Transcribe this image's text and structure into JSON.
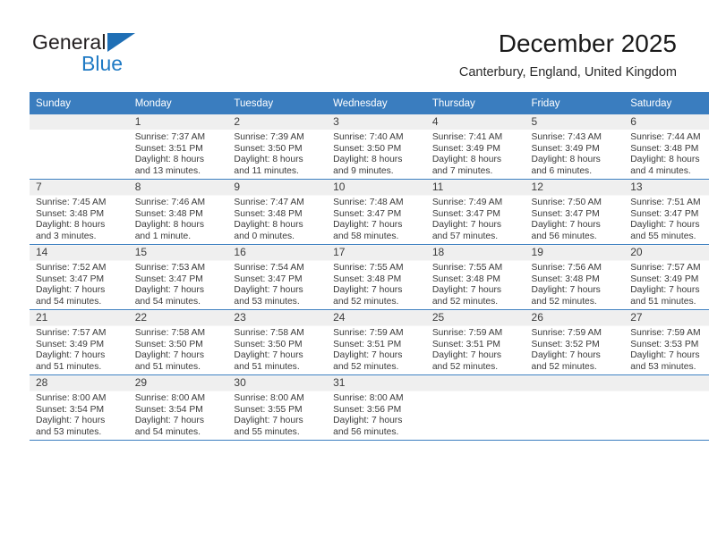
{
  "brand": {
    "name_part1": "General",
    "name_part2": "Blue",
    "triangle_icon": "blue-triangle-icon",
    "colors": {
      "triangle": "#1f6fb5",
      "blue_text": "#1f7ac4",
      "dark_text": "#231f20"
    }
  },
  "header": {
    "title": "December 2025",
    "subtitle": "Canterbury, England, United Kingdom"
  },
  "theme": {
    "header_row_bg": "#3a7dbf",
    "header_row_text": "#ffffff",
    "daynum_band_bg": "#efefef",
    "cell_bg": "#ffffff",
    "row_border": "#3a7dbf"
  },
  "weekday_headers": [
    "Sunday",
    "Monday",
    "Tuesday",
    "Wednesday",
    "Thursday",
    "Friday",
    "Saturday"
  ],
  "weeks": [
    [
      {
        "day": "",
        "lines": []
      },
      {
        "day": "1",
        "lines": [
          "Sunrise: 7:37 AM",
          "Sunset: 3:51 PM",
          "Daylight: 8 hours",
          "and 13 minutes."
        ]
      },
      {
        "day": "2",
        "lines": [
          "Sunrise: 7:39 AM",
          "Sunset: 3:50 PM",
          "Daylight: 8 hours",
          "and 11 minutes."
        ]
      },
      {
        "day": "3",
        "lines": [
          "Sunrise: 7:40 AM",
          "Sunset: 3:50 PM",
          "Daylight: 8 hours",
          "and 9 minutes."
        ]
      },
      {
        "day": "4",
        "lines": [
          "Sunrise: 7:41 AM",
          "Sunset: 3:49 PM",
          "Daylight: 8 hours",
          "and 7 minutes."
        ]
      },
      {
        "day": "5",
        "lines": [
          "Sunrise: 7:43 AM",
          "Sunset: 3:49 PM",
          "Daylight: 8 hours",
          "and 6 minutes."
        ]
      },
      {
        "day": "6",
        "lines": [
          "Sunrise: 7:44 AM",
          "Sunset: 3:48 PM",
          "Daylight: 8 hours",
          "and 4 minutes."
        ]
      }
    ],
    [
      {
        "day": "7",
        "lines": [
          "Sunrise: 7:45 AM",
          "Sunset: 3:48 PM",
          "Daylight: 8 hours",
          "and 3 minutes."
        ]
      },
      {
        "day": "8",
        "lines": [
          "Sunrise: 7:46 AM",
          "Sunset: 3:48 PM",
          "Daylight: 8 hours",
          "and 1 minute."
        ]
      },
      {
        "day": "9",
        "lines": [
          "Sunrise: 7:47 AM",
          "Sunset: 3:48 PM",
          "Daylight: 8 hours",
          "and 0 minutes."
        ]
      },
      {
        "day": "10",
        "lines": [
          "Sunrise: 7:48 AM",
          "Sunset: 3:47 PM",
          "Daylight: 7 hours",
          "and 58 minutes."
        ]
      },
      {
        "day": "11",
        "lines": [
          "Sunrise: 7:49 AM",
          "Sunset: 3:47 PM",
          "Daylight: 7 hours",
          "and 57 minutes."
        ]
      },
      {
        "day": "12",
        "lines": [
          "Sunrise: 7:50 AM",
          "Sunset: 3:47 PM",
          "Daylight: 7 hours",
          "and 56 minutes."
        ]
      },
      {
        "day": "13",
        "lines": [
          "Sunrise: 7:51 AM",
          "Sunset: 3:47 PM",
          "Daylight: 7 hours",
          "and 55 minutes."
        ]
      }
    ],
    [
      {
        "day": "14",
        "lines": [
          "Sunrise: 7:52 AM",
          "Sunset: 3:47 PM",
          "Daylight: 7 hours",
          "and 54 minutes."
        ]
      },
      {
        "day": "15",
        "lines": [
          "Sunrise: 7:53 AM",
          "Sunset: 3:47 PM",
          "Daylight: 7 hours",
          "and 54 minutes."
        ]
      },
      {
        "day": "16",
        "lines": [
          "Sunrise: 7:54 AM",
          "Sunset: 3:47 PM",
          "Daylight: 7 hours",
          "and 53 minutes."
        ]
      },
      {
        "day": "17",
        "lines": [
          "Sunrise: 7:55 AM",
          "Sunset: 3:48 PM",
          "Daylight: 7 hours",
          "and 52 minutes."
        ]
      },
      {
        "day": "18",
        "lines": [
          "Sunrise: 7:55 AM",
          "Sunset: 3:48 PM",
          "Daylight: 7 hours",
          "and 52 minutes."
        ]
      },
      {
        "day": "19",
        "lines": [
          "Sunrise: 7:56 AM",
          "Sunset: 3:48 PM",
          "Daylight: 7 hours",
          "and 52 minutes."
        ]
      },
      {
        "day": "20",
        "lines": [
          "Sunrise: 7:57 AM",
          "Sunset: 3:49 PM",
          "Daylight: 7 hours",
          "and 51 minutes."
        ]
      }
    ],
    [
      {
        "day": "21",
        "lines": [
          "Sunrise: 7:57 AM",
          "Sunset: 3:49 PM",
          "Daylight: 7 hours",
          "and 51 minutes."
        ]
      },
      {
        "day": "22",
        "lines": [
          "Sunrise: 7:58 AM",
          "Sunset: 3:50 PM",
          "Daylight: 7 hours",
          "and 51 minutes."
        ]
      },
      {
        "day": "23",
        "lines": [
          "Sunrise: 7:58 AM",
          "Sunset: 3:50 PM",
          "Daylight: 7 hours",
          "and 51 minutes."
        ]
      },
      {
        "day": "24",
        "lines": [
          "Sunrise: 7:59 AM",
          "Sunset: 3:51 PM",
          "Daylight: 7 hours",
          "and 52 minutes."
        ]
      },
      {
        "day": "25",
        "lines": [
          "Sunrise: 7:59 AM",
          "Sunset: 3:51 PM",
          "Daylight: 7 hours",
          "and 52 minutes."
        ]
      },
      {
        "day": "26",
        "lines": [
          "Sunrise: 7:59 AM",
          "Sunset: 3:52 PM",
          "Daylight: 7 hours",
          "and 52 minutes."
        ]
      },
      {
        "day": "27",
        "lines": [
          "Sunrise: 7:59 AM",
          "Sunset: 3:53 PM",
          "Daylight: 7 hours",
          "and 53 minutes."
        ]
      }
    ],
    [
      {
        "day": "28",
        "lines": [
          "Sunrise: 8:00 AM",
          "Sunset: 3:54 PM",
          "Daylight: 7 hours",
          "and 53 minutes."
        ]
      },
      {
        "day": "29",
        "lines": [
          "Sunrise: 8:00 AM",
          "Sunset: 3:54 PM",
          "Daylight: 7 hours",
          "and 54 minutes."
        ]
      },
      {
        "day": "30",
        "lines": [
          "Sunrise: 8:00 AM",
          "Sunset: 3:55 PM",
          "Daylight: 7 hours",
          "and 55 minutes."
        ]
      },
      {
        "day": "31",
        "lines": [
          "Sunrise: 8:00 AM",
          "Sunset: 3:56 PM",
          "Daylight: 7 hours",
          "and 56 minutes."
        ]
      },
      {
        "day": "",
        "lines": []
      },
      {
        "day": "",
        "lines": []
      },
      {
        "day": "",
        "lines": []
      }
    ]
  ]
}
